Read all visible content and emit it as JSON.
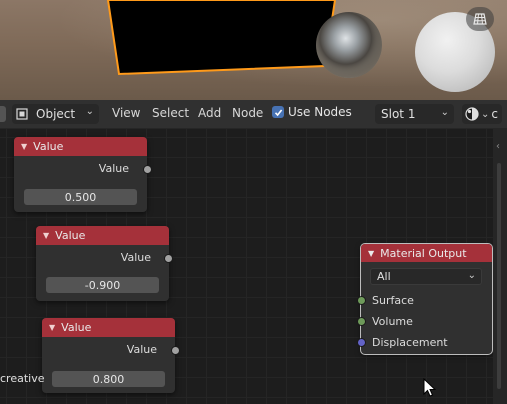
{
  "viewport": {
    "grid_icon": "viewport-grid-icon"
  },
  "header": {
    "mode_icon": "object-mode-icon",
    "mode_label": "Object",
    "menus": [
      "View",
      "Select",
      "Add",
      "Node"
    ],
    "use_nodes_label": "Use Nodes",
    "use_nodes_checked": true,
    "slot_label": "Slot 1",
    "shading_icon": "shading-sphere-icon",
    "overflow_text": "c"
  },
  "nodes": [
    {
      "title": "Value",
      "output_label": "Value",
      "value": "0.500"
    },
    {
      "title": "Value",
      "output_label": "Value",
      "value": "-0.900"
    },
    {
      "title": "Value",
      "output_label": "Value",
      "value": "0.800"
    }
  ],
  "material_output": {
    "title": "Material Output",
    "target": "All",
    "inputs": [
      "Surface",
      "Volume",
      "Displacement"
    ]
  },
  "side_text": "creative",
  "colors": {
    "node_header": "#a5313a",
    "accent": "#4772b3",
    "shader_socket": "#6e9a5a",
    "float_socket": "#a1a1a1",
    "vector_socket": "#6363c7",
    "selection_outline": "#ff9a1a"
  }
}
